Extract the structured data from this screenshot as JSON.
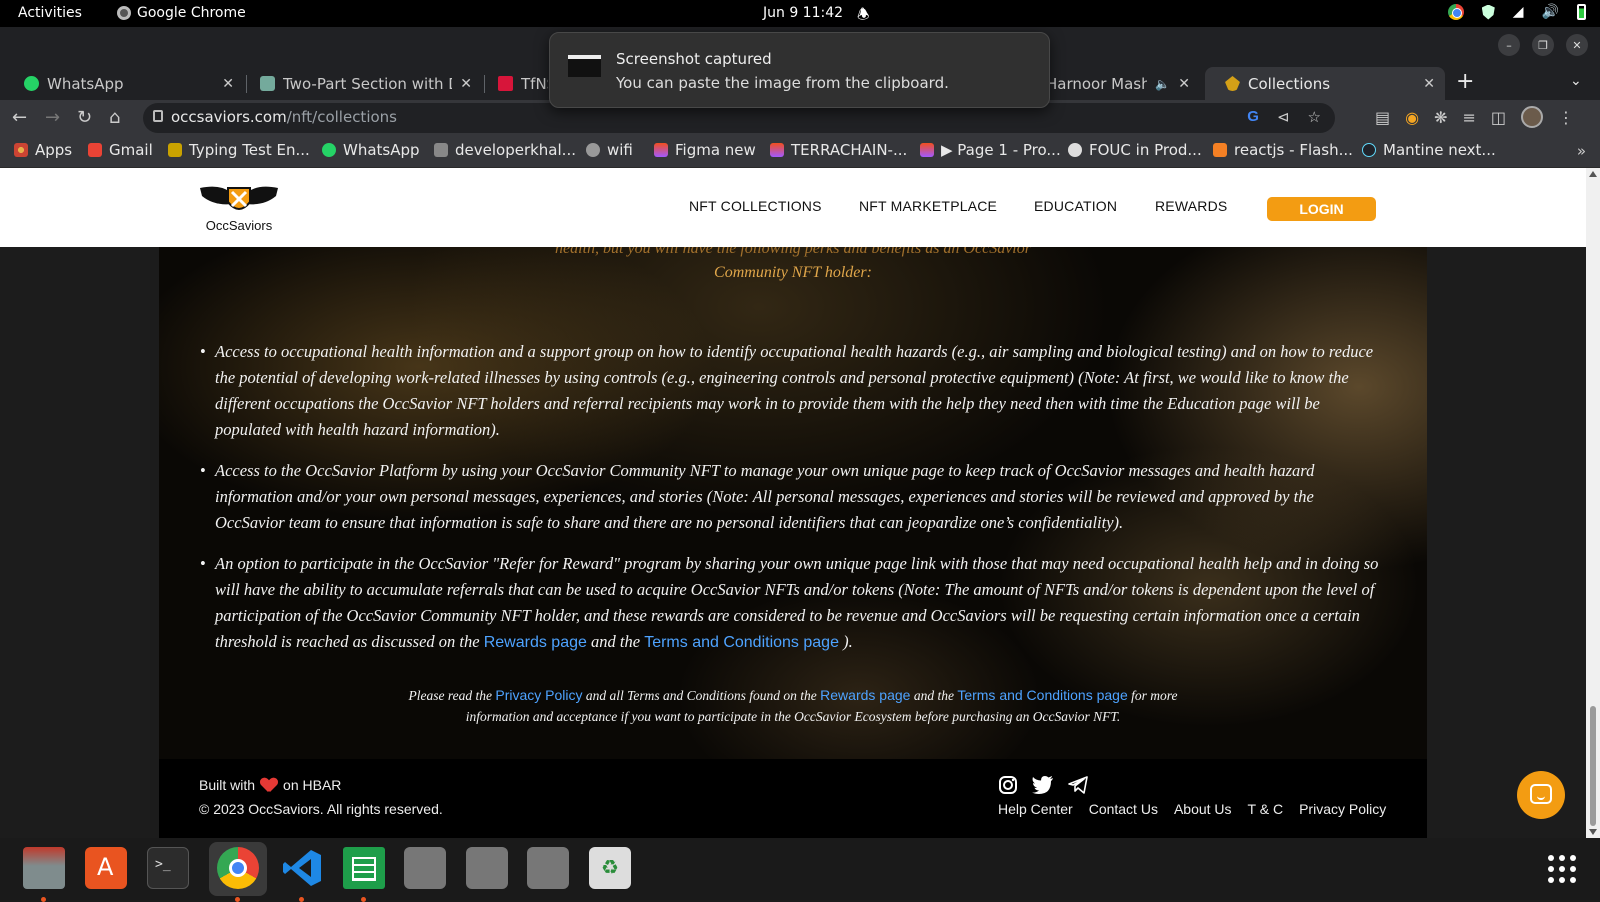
{
  "topbar": {
    "activities": "Activities",
    "app_name": "Google Chrome",
    "clock": "Jun 9  11:42"
  },
  "browser": {
    "tabs": [
      {
        "title": "WhatsApp",
        "active": false
      },
      {
        "title": "Two-Part Section with Div",
        "active": false
      },
      {
        "title": "TfNSW",
        "active": false
      },
      {
        "title": "Harnoor Mashu",
        "active": false
      },
      {
        "title": "Collections",
        "active": true
      }
    ],
    "url_host": "occsaviors.com",
    "url_path": "/nft/collections",
    "bookmarks": [
      "Apps",
      "Gmail",
      "Typing Test En...",
      "WhatsApp",
      "developerkhal...",
      "wifi",
      "Figma new",
      "TERRACHAIN-...",
      "▶ Page 1 - Pro...",
      "FOUC in Prod...",
      "reactjs - Flash...",
      "Mantine next..."
    ],
    "bookmarks_more": "»"
  },
  "toast": {
    "title": "Screenshot captured",
    "body": "You can paste the image from the clipboard."
  },
  "site": {
    "logo_text": "OccSaviors",
    "nav": [
      "NFT COLLECTIONS",
      "NFT MARKETPLACE",
      "EDUCATION",
      "REWARDS"
    ],
    "login": "LOGIN",
    "intro_cut_line": "health, but you will have the following perks and benefits as an OccSavior",
    "intro_last_line": "Community NFT holder:",
    "benefits": [
      "Access to occupational health information and a support group on how to identify occupational health hazards (e.g., air sampling and biological testing) and on how to reduce the potential of developing work-related illnesses by using controls (e.g., engineering controls and personal protective equipment) (Note: At first, we would like to know the different occupations the OccSavior NFT holders and referral recipients may work in to provide them with the help they need then with time the Education page will be populated with health hazard information).",
      "Access to the OccSavior Platform by using your OccSavior Community NFT to manage your own unique page to keep track of OccSavior messages and health hazard information and/or your own personal messages, experiences, and stories (Note: All personal messages, experiences and stories will be reviewed and approved by the OccSavior team to ensure that information is safe to share and there are no personal identifiers that can jeopardize one’s confidentiality).",
      "An option to participate in the OccSavior \"Refer for Reward\" program by sharing your own unique page link with those that may need occupational health help and in doing so will have the ability to accumulate referrals that can be used to acquire OccSavior NFTs and/or tokens (Note: The amount of NFTs and/or tokens is dependent upon the level of participation of the OccSavior Community NFT holder, and these rewards are considered to be revenue and OccSaviors will be requesting certain information once a certain threshold is reached as discussed on the"
    ],
    "benefit3_link1": "Rewards page",
    "benefit3_mid": " and the ",
    "benefit3_link2": "Terms and Conditions page",
    "benefit3_end": " ).",
    "fine_print": {
      "p1": "Please read the ",
      "link1": "Privacy Policy",
      "p2": " and all Terms and Conditions found on the ",
      "link2": "Rewards page",
      "p3": " and the ",
      "link3": "Terms and Conditions page",
      "p4": " for more",
      "line2": "information and acceptance if you want to participate in the OccSavior Ecosystem before purchasing an OccSavior NFT."
    },
    "footer": {
      "built_prefix": "Built with",
      "built_suffix": "on HBAR",
      "copyright": "© 2023 OccSaviors. All rights reserved.",
      "links": [
        "Help Center",
        "Contact Us",
        "About Us",
        "T & C",
        "Privacy Policy"
      ]
    },
    "colors": {
      "accent": "#f39c12",
      "link": "#4ea3ff",
      "intro_text": "#e0a64a"
    }
  },
  "dock": {
    "apps": [
      "files-icon",
      "app-center-icon",
      "terminal-icon",
      "chrome-icon",
      "vscode-icon",
      "spreadsheet-icon",
      "generic-app-icon",
      "generic-app-icon",
      "generic-app-icon",
      "trash-icon"
    ]
  }
}
